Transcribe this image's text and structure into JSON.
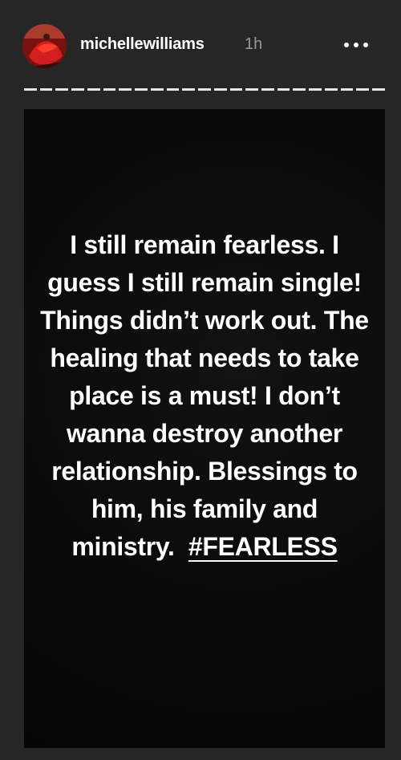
{
  "header": {
    "username": "michellewilliams",
    "time": "1h",
    "more_icon": "more-horizontal-icon"
  },
  "progress": {
    "segments": 23,
    "color": "#e6e6e6"
  },
  "story": {
    "background": "#0a0a0a",
    "text": "I still remain fearless. I guess I still remain single! Things didn’t work out. The healing that needs to take place is a must! I don’t wanna destroy another relationship. Blessings to him, his family and ministry.",
    "hashtag": "#FEARLESS"
  },
  "colors": {
    "page_background": "#262626",
    "text": "#ffffff",
    "muted": "#9a9a9a"
  }
}
